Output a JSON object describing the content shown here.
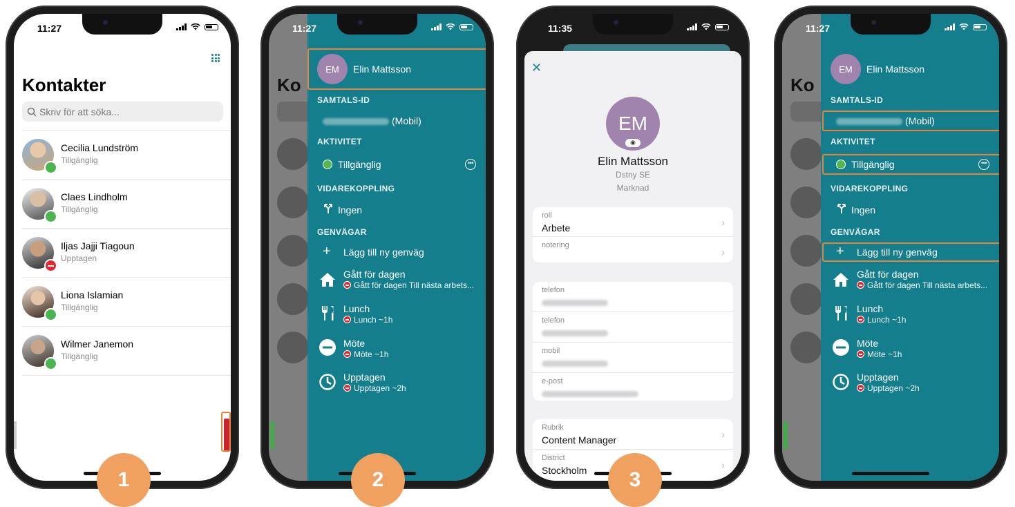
{
  "phones": {
    "p1": {
      "time": "11:27",
      "title": "Kontakter",
      "search_placeholder": "Skriv för att söka...",
      "contacts": [
        {
          "name": "Cecilia Lundström",
          "status": "Tillgänglig",
          "presence": "available"
        },
        {
          "name": "Claes Lindholm",
          "status": "Tillgänglig",
          "presence": "available"
        },
        {
          "name": "Iljas Jajji Tiagoun",
          "status": "Upptagen",
          "presence": "busy"
        },
        {
          "name": "Liona Islamian",
          "status": "Tillgänglig",
          "presence": "available"
        },
        {
          "name": "Wilmer Janemon",
          "status": "Tillgänglig",
          "presence": "available"
        }
      ]
    },
    "p2": {
      "time": "11:27"
    },
    "p3": {
      "time": "11:35"
    },
    "p4": {
      "time": "11:27"
    }
  },
  "bg_title_peek": "Ko",
  "drawer": {
    "initials": "EM",
    "name": "Elin Mattsson",
    "call_id_header": "SAMTALS-ID",
    "call_id_suffix": "(Mobil)",
    "activity_header": "AKTIVITET",
    "activity_value": "Tillgänglig",
    "forwarding_header": "VIDAREKOPPLING",
    "forwarding_value": "Ingen",
    "shortcuts_header": "GENVÄGAR",
    "add_shortcut": "Lägg till ny genväg",
    "shortcuts": [
      {
        "title": "Gått för dagen",
        "sub": "Gått för dagen Till nästa arbets...",
        "icon": "home-icon"
      },
      {
        "title": "Lunch",
        "sub": "Lunch ~1h",
        "icon": "cutlery-icon"
      },
      {
        "title": "Möte",
        "sub": "Möte ~1h",
        "icon": "minus-circle-icon"
      },
      {
        "title": "Upptagen",
        "sub": "Upptagen ~2h",
        "icon": "clock-icon"
      }
    ]
  },
  "profile": {
    "close": "✕",
    "initials": "EM",
    "name": "Elin Mattsson",
    "company": "Dstny SE",
    "department": "Marknad",
    "card1": [
      {
        "label": "roll",
        "value": "Arbete"
      },
      {
        "label": "notering",
        "value": ""
      }
    ],
    "card2_labels": [
      "telefon",
      "telefon",
      "mobil",
      "e-post"
    ],
    "card3": [
      {
        "label": "Rubrik",
        "value": "Content Manager"
      },
      {
        "label": "District",
        "value": "Stockholm"
      }
    ]
  },
  "steps": [
    "1",
    "2",
    "3"
  ],
  "colors": {
    "teal": "#157e8d",
    "accent_orange": "#e8823a",
    "step_circle": "#f0a15f",
    "available": "#4bb54f",
    "busy": "#e0262e",
    "avatar_purple": "#a184ad"
  }
}
